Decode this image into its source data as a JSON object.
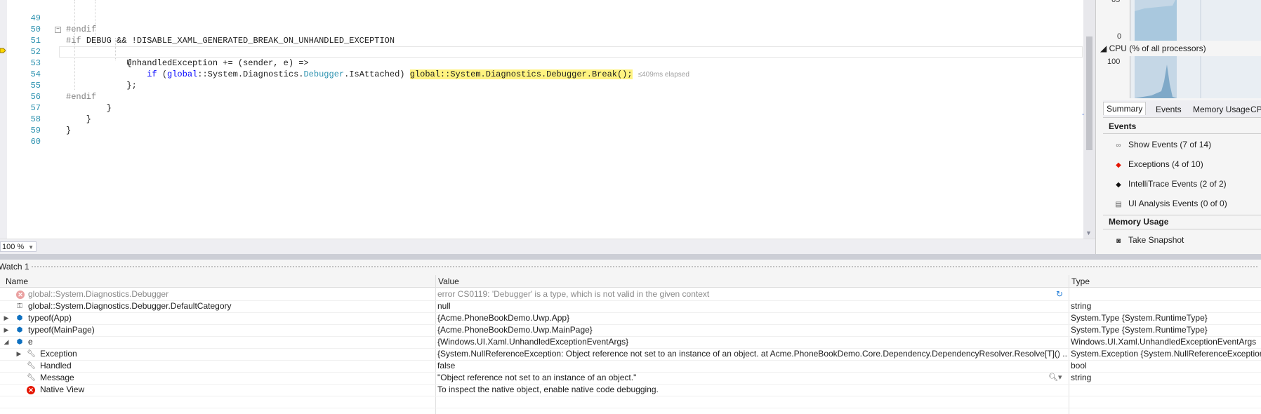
{
  "editor": {
    "lines": [
      {
        "n": "49",
        "kind": "pp",
        "text": "#endif"
      },
      {
        "n": "50",
        "kind": "pp-if",
        "directive": "#if",
        "cond": "DEBUG && !DISABLE_XAML_GENERATED_BREAK_ON_UNHANDLED_EXCEPTION"
      },
      {
        "n": "51",
        "text": "            UnhandledException += (sender, e) =>"
      },
      {
        "n": "52",
        "text": "            {"
      },
      {
        "n": "53",
        "kind": "current"
      },
      {
        "n": "54",
        "text": "            };"
      },
      {
        "n": "55",
        "kind": "pp",
        "text": "#endif"
      },
      {
        "n": "56",
        "text": "        }"
      },
      {
        "n": "57",
        "text": "    }"
      },
      {
        "n": "58",
        "text": "}"
      },
      {
        "n": "59",
        "text": ""
      },
      {
        "n": "60",
        "text": ""
      }
    ],
    "current_line": {
      "indent": "                ",
      "if_kw": "if",
      "open": " (",
      "global1": "global",
      "ns1": "::System.Diagnostics.",
      "debugger_type": "Debugger",
      "tail": ".IsAttached) ",
      "break_stmt": "global::System.Diagnostics.Debugger.Break();",
      "elapsed": "≤409ms elapsed"
    },
    "zoom": "100 %"
  },
  "diagnostics": {
    "graph1": {
      "tick_top": "65",
      "tick_bottom": "0"
    },
    "cpu_title": "◢ CPU (% of all processors)",
    "graph2": {
      "tick_top": "100"
    },
    "tabs": [
      "Summary",
      "Events",
      "Memory Usage",
      "CP"
    ],
    "events_heading": "Events",
    "events": [
      {
        "icon": "show-events-icon",
        "label": "Show Events (7 of 14)"
      },
      {
        "icon": "exception-diamond-icon",
        "label": "Exceptions (4 of 10)"
      },
      {
        "icon": "intellitrace-diamond-icon",
        "label": "IntelliTrace Events (2 of 2)"
      },
      {
        "icon": "ui-analysis-icon",
        "label": "UI Analysis Events (0 of 0)"
      }
    ],
    "memory_heading": "Memory Usage",
    "snapshot_label": "Take Snapshot",
    "colors": {
      "exception": "#e51400",
      "graph_fill": "#a9c8de"
    }
  },
  "watch": {
    "title": "Watch 1",
    "columns": {
      "name": "Name",
      "value": "Value",
      "type": "Type"
    },
    "rows": [
      {
        "name": "global::System.Diagnostics.Debugger",
        "value": "error CS0119: 'Debugger' is a type, which is not valid in the given context",
        "type": ""
      },
      {
        "name": "global::System.Diagnostics.Debugger.DefaultCategory",
        "value": "null",
        "type": "string"
      },
      {
        "name": "typeof(App)",
        "value": "{Acme.PhoneBookDemo.Uwp.App}",
        "type": "System.Type {System.RuntimeType}"
      },
      {
        "name": "typeof(MainPage)",
        "value": "{Acme.PhoneBookDemo.Uwp.MainPage}",
        "type": "System.Type {System.RuntimeType}"
      },
      {
        "name": "e",
        "value": "{Windows.UI.Xaml.UnhandledExceptionEventArgs}",
        "type": "Windows.UI.Xaml.UnhandledExceptionEventArgs"
      },
      {
        "name": "Exception",
        "value": "{System.NullReferenceException: Object reference not set to an instance of an object.    at Acme.PhoneBookDemo.Core.Dependency.DependencyResolver.Resolve[T]()  ...",
        "type": "System.Exception {System.NullReferenceException}"
      },
      {
        "name": "Handled",
        "value": "false",
        "type": "bool"
      },
      {
        "name": "Message",
        "value": "\"Object reference not set to an instance of an object.\"",
        "type": "string"
      },
      {
        "name": "Native View",
        "value": "To inspect the native object, enable native code debugging.",
        "type": ""
      }
    ]
  }
}
